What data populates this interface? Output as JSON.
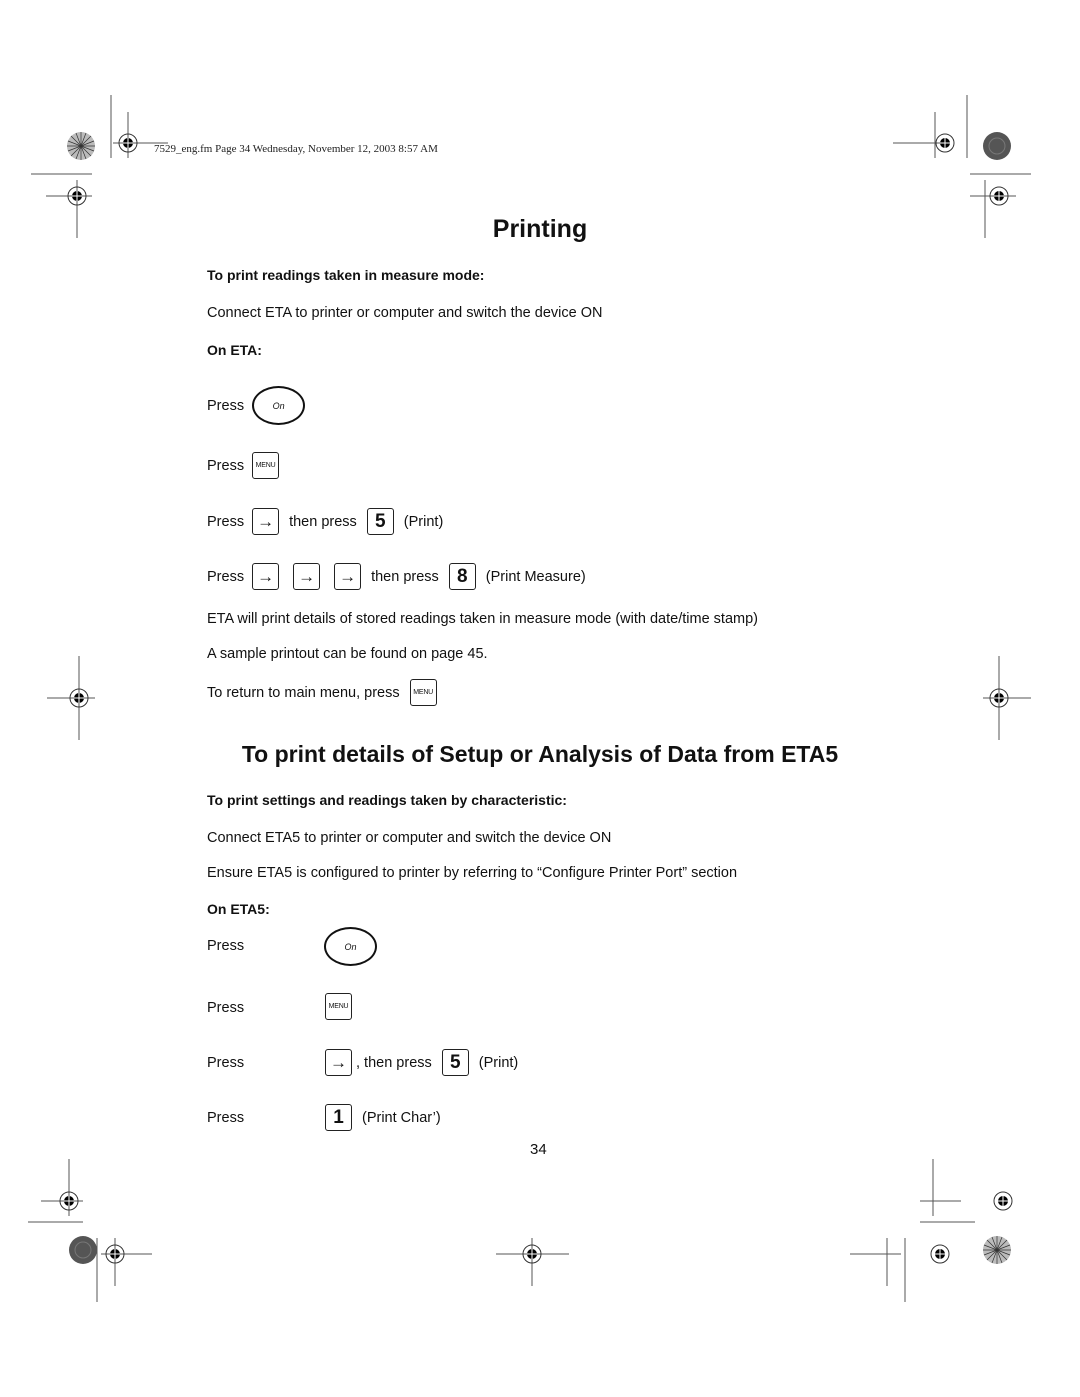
{
  "header": {
    "slug_line": "7529_eng.fm  Page 34  Wednesday, November 12, 2003  8:57 AM"
  },
  "section1": {
    "title": "Printing",
    "subheading": "To print readings taken in measure mode:",
    "intro": "Connect ETA to printer or computer and switch the device ON",
    "device_label": "On ETA:",
    "steps": [
      {
        "press": "Press",
        "key": "On"
      },
      {
        "press": "Press",
        "key": "MENU"
      },
      {
        "press": "Press",
        "key": "→",
        "then": "then press",
        "key2": "5",
        "note": "(Print)"
      },
      {
        "press": "Press",
        "keys": [
          "→",
          "→",
          "→"
        ],
        "then": "then press",
        "key2": "8",
        "note": "(Print Measure)"
      }
    ],
    "result": "ETA will print details of stored readings taken in measure mode (with date/time stamp)",
    "sample": "A sample printout can be found on page 45.",
    "return_text": "To return to main menu, press",
    "return_key": "MENU"
  },
  "section2": {
    "title": "To print details of Setup or Analysis of Data from ETA5",
    "subheading": "To print settings and readings taken by characteristic:",
    "intro": "Connect ETA5 to printer or computer and switch the device ON",
    "ensure": "Ensure ETA5 is configured to printer by referring to “Configure Printer Port” section",
    "device_label": "On ETA5:",
    "steps": [
      {
        "press": "Press",
        "key": "On"
      },
      {
        "press": "Press",
        "key": "MENU"
      },
      {
        "press": "Press",
        "key": "→",
        "then": ", then press",
        "key2": "5",
        "note": "(Print)"
      },
      {
        "press": "Press",
        "key": "1",
        "note": "(Print Char’)"
      }
    ]
  },
  "footer": {
    "page_number": "34"
  }
}
